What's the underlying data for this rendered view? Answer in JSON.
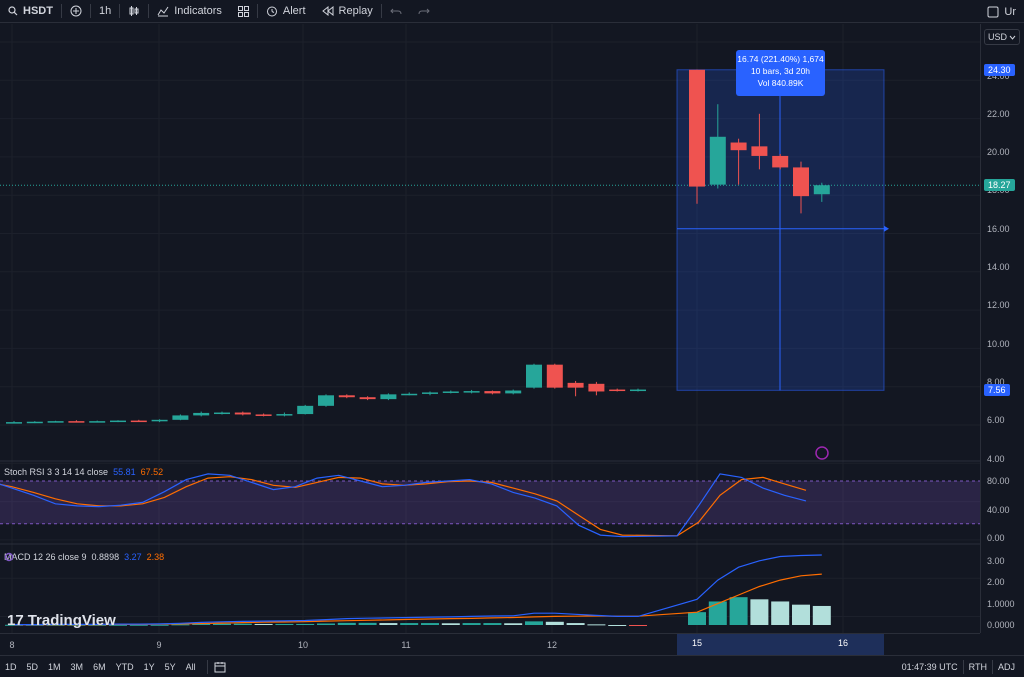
{
  "toolbar": {
    "symbol": "HSDT",
    "interval": "1h",
    "indicators_label": "Indicators",
    "alert_label": "Alert",
    "replay_label": "Replay",
    "right_label": "Ur"
  },
  "price_axis": {
    "currency": "USD",
    "ticks": [
      "24.00",
      "22.00",
      "20.00",
      "18.00",
      "16.00",
      "14.00",
      "12.00",
      "10.00",
      "8.00",
      "6.00",
      "4.00"
    ],
    "top_tag": "24.30",
    "current_tag": "18.27",
    "bottom_tag": "7.56",
    "colors": {
      "top_tag": "#2962ff",
      "current_tag": "#26a69a",
      "bottom_tag": "#2962ff"
    }
  },
  "measure_tooltip": {
    "line1": "16.74 (221.40%) 1,674",
    "line2": "10 bars, 3d 20h",
    "line3": "Vol 840.89K"
  },
  "stoch_rsi": {
    "title": "Stoch RSI 3 3 14 14 close",
    "k_value": "55.81",
    "d_value": "67.52",
    "ticks": [
      "80.00",
      "40.00",
      "0.00"
    ]
  },
  "macd": {
    "title": "MACD 12 26 close 9",
    "hist_value": "0.8898",
    "macd_value": "3.27",
    "signal_value": "2.38",
    "ticks": [
      "3.00",
      "2.00",
      "1.0000",
      "0.0000"
    ]
  },
  "time_axis": {
    "labels": [
      "8",
      "9",
      "10",
      "11",
      "12",
      "15",
      "16"
    ]
  },
  "bottom_bar": {
    "ranges": [
      "1D",
      "5D",
      "1M",
      "3M",
      "6M",
      "YTD",
      "1Y",
      "5Y",
      "All"
    ],
    "time": "01:47:39 UTC",
    "rth": "RTH",
    "adj": "ADJ"
  },
  "watermark": "TradingView",
  "chart_data": {
    "type": "candlestick",
    "ylim": [
      4,
      25
    ],
    "candles": [
      {
        "o": 5.9,
        "h": 5.95,
        "l": 5.85,
        "c": 5.9
      },
      {
        "o": 5.9,
        "h": 5.95,
        "l": 5.85,
        "c": 5.92
      },
      {
        "o": 5.92,
        "h": 5.97,
        "l": 5.88,
        "c": 5.95
      },
      {
        "o": 5.95,
        "h": 6.0,
        "l": 5.9,
        "c": 5.93
      },
      {
        "o": 5.93,
        "h": 5.98,
        "l": 5.88,
        "c": 5.95
      },
      {
        "o": 5.95,
        "h": 6.0,
        "l": 5.9,
        "c": 5.98
      },
      {
        "o": 5.98,
        "h": 6.02,
        "l": 5.92,
        "c": 5.96
      },
      {
        "o": 5.96,
        "h": 6.05,
        "l": 5.9,
        "c": 6.02
      },
      {
        "o": 6.02,
        "h": 6.3,
        "l": 6.0,
        "c": 6.25
      },
      {
        "o": 6.25,
        "h": 6.45,
        "l": 6.2,
        "c": 6.38
      },
      {
        "o": 6.38,
        "h": 6.45,
        "l": 6.3,
        "c": 6.4
      },
      {
        "o": 6.4,
        "h": 6.45,
        "l": 6.25,
        "c": 6.3
      },
      {
        "o": 6.3,
        "h": 6.35,
        "l": 6.2,
        "c": 6.25
      },
      {
        "o": 6.25,
        "h": 6.4,
        "l": 6.2,
        "c": 6.32
      },
      {
        "o": 6.32,
        "h": 6.8,
        "l": 6.3,
        "c": 6.75
      },
      {
        "o": 6.75,
        "h": 7.35,
        "l": 6.7,
        "c": 7.3
      },
      {
        "o": 7.3,
        "h": 7.35,
        "l": 7.15,
        "c": 7.2
      },
      {
        "o": 7.2,
        "h": 7.25,
        "l": 7.05,
        "c": 7.1
      },
      {
        "o": 7.1,
        "h": 7.4,
        "l": 7.05,
        "c": 7.35
      },
      {
        "o": 7.35,
        "h": 7.45,
        "l": 7.3,
        "c": 7.38
      },
      {
        "o": 7.38,
        "h": 7.5,
        "l": 7.3,
        "c": 7.45
      },
      {
        "o": 7.45,
        "h": 7.55,
        "l": 7.4,
        "c": 7.5
      },
      {
        "o": 7.5,
        "h": 7.58,
        "l": 7.4,
        "c": 7.52
      },
      {
        "o": 7.52,
        "h": 7.55,
        "l": 7.35,
        "c": 7.4
      },
      {
        "o": 7.4,
        "h": 7.6,
        "l": 7.35,
        "c": 7.55
      },
      {
        "o": 7.7,
        "h": 8.95,
        "l": 7.65,
        "c": 8.9
      },
      {
        "o": 8.9,
        "h": 8.95,
        "l": 7.65,
        "c": 7.7
      },
      {
        "o": 7.95,
        "h": 8.05,
        "l": 7.25,
        "c": 7.7
      },
      {
        "o": 7.9,
        "h": 8.0,
        "l": 7.3,
        "c": 7.5
      },
      {
        "o": 7.6,
        "h": 7.65,
        "l": 7.5,
        "c": 7.55
      },
      {
        "o": 7.55,
        "h": 7.65,
        "l": 7.5,
        "c": 7.6
      },
      {
        "o": 24.3,
        "h": 24.3,
        "l": 17.3,
        "c": 18.2
      },
      {
        "o": 18.3,
        "h": 22.5,
        "l": 18.1,
        "c": 20.8
      },
      {
        "o": 20.5,
        "h": 20.7,
        "l": 18.3,
        "c": 20.1
      },
      {
        "o": 20.3,
        "h": 22.0,
        "l": 19.1,
        "c": 19.8
      },
      {
        "o": 19.8,
        "h": 19.9,
        "l": 19.1,
        "c": 19.2
      },
      {
        "o": 19.2,
        "h": 19.5,
        "l": 16.8,
        "c": 17.7
      },
      {
        "o": 17.8,
        "h": 18.4,
        "l": 17.4,
        "c": 18.27
      }
    ],
    "stoch_k": [
      80,
      70,
      60,
      48,
      45,
      44,
      46,
      50,
      65,
      82,
      90,
      88,
      78,
      68,
      72,
      84,
      88,
      80,
      72,
      74,
      78,
      80,
      82,
      76,
      64,
      56,
      45,
      18,
      4,
      2,
      3,
      45,
      90,
      85,
      70,
      60,
      52
    ],
    "stoch_d": [
      78,
      72,
      64,
      55,
      48,
      45,
      45,
      48,
      57,
      72,
      84,
      86,
      82,
      74,
      71,
      78,
      85,
      84,
      76,
      74,
      76,
      79,
      80,
      78,
      70,
      62,
      52,
      32,
      12,
      4,
      3,
      22,
      60,
      82,
      85,
      76,
      67
    ],
    "macd_line": [
      0.02,
      0.02,
      0.03,
      0.03,
      0.03,
      0.04,
      0.04,
      0.05,
      0.08,
      0.12,
      0.15,
      0.17,
      0.18,
      0.19,
      0.21,
      0.25,
      0.3,
      0.32,
      0.33,
      0.35,
      0.37,
      0.38,
      0.4,
      0.42,
      0.43,
      0.55,
      0.55,
      0.5,
      0.45,
      0.4,
      0.4,
      1.2,
      2.1,
      2.7,
      3.0,
      3.2,
      3.25,
      3.27
    ],
    "signal_line": [
      0.01,
      0.01,
      0.02,
      0.02,
      0.02,
      0.03,
      0.03,
      0.04,
      0.05,
      0.07,
      0.09,
      0.11,
      0.13,
      0.14,
      0.16,
      0.18,
      0.2,
      0.22,
      0.24,
      0.26,
      0.28,
      0.3,
      0.31,
      0.33,
      0.35,
      0.38,
      0.4,
      0.41,
      0.42,
      0.41,
      0.41,
      0.6,
      1.0,
      1.4,
      1.8,
      2.1,
      2.3,
      2.38
    ],
    "macd_hist": [
      0.01,
      0.01,
      0.01,
      0.01,
      0.01,
      0.01,
      0.01,
      0.01,
      0.03,
      0.05,
      0.06,
      0.06,
      0.05,
      0.05,
      0.05,
      0.07,
      0.1,
      0.1,
      0.09,
      0.09,
      0.09,
      0.08,
      0.09,
      0.09,
      0.08,
      0.17,
      0.15,
      0.09,
      0.03,
      -0.01,
      -0.01,
      0.6,
      1.1,
      1.3,
      1.2,
      1.1,
      0.95,
      0.89
    ],
    "colors": {
      "up": "#26a69a",
      "down": "#ef5350",
      "k": "#2962ff",
      "d": "#ff6d00",
      "band": "#7e57c2",
      "measure": "#2962ff"
    }
  }
}
